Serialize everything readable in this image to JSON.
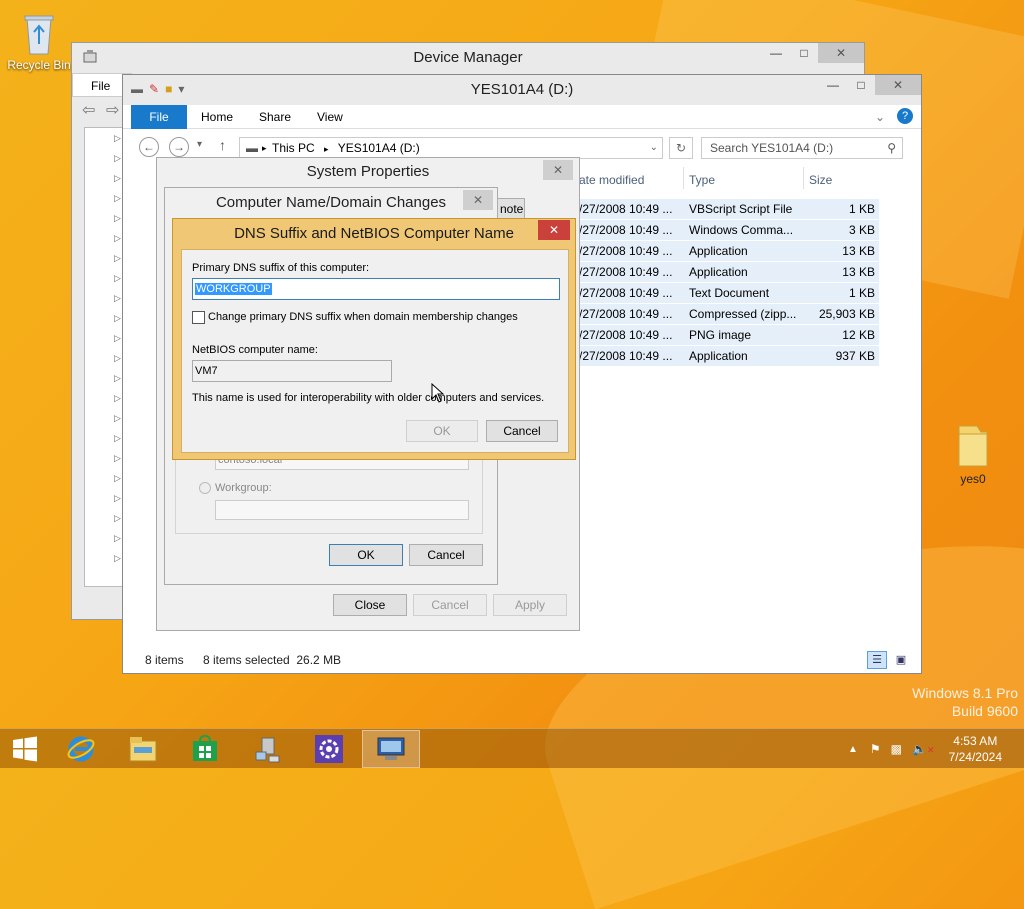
{
  "desktop": {
    "icons": [
      {
        "label": "Recycle Bin",
        "icon": "recycle-bin-icon"
      },
      {
        "label": "yes0",
        "icon": "folder-icon"
      }
    ],
    "watermark": {
      "line1": "Windows 8.1 Pro",
      "line2": "Build 9600"
    }
  },
  "device_manager": {
    "title": "Device Manager",
    "menu": {
      "file": "File"
    }
  },
  "explorer": {
    "title": "YES101A4 (D:)",
    "ribbon_tabs": [
      "File",
      "Home",
      "Share",
      "View"
    ],
    "address": {
      "crumb1": "This PC",
      "crumb2": "YES101A4 (D:)"
    },
    "search_placeholder": "Search YES101A4 (D:)",
    "columns": {
      "date": "ate modified",
      "type": "Type",
      "size": "Size"
    },
    "files": [
      {
        "date": "/27/2008 10:49 ...",
        "type": "VBScript Script File",
        "size": "1 KB"
      },
      {
        "date": "/27/2008 10:49 ...",
        "type": "Windows Comma...",
        "size": "3 KB"
      },
      {
        "date": "/27/2008 10:49 ...",
        "type": "Application",
        "size": "13 KB"
      },
      {
        "date": "/27/2008 10:49 ...",
        "type": "Application",
        "size": "13 KB"
      },
      {
        "date": "/27/2008 10:49 ...",
        "type": "Text Document",
        "size": "1 KB"
      },
      {
        "date": "/27/2008 10:49 ...",
        "type": "Compressed (zipp...",
        "size": "25,903 KB"
      },
      {
        "date": "/27/2008 10:49 ...",
        "type": "PNG image",
        "size": "12 KB"
      },
      {
        "date": "/27/2008 10:49 ...",
        "type": "Application",
        "size": "937 KB"
      }
    ],
    "status": {
      "count": "8 items",
      "selected": "8 items selected  26.2 MB"
    }
  },
  "system_properties": {
    "title": "System Properties",
    "buttons": {
      "close": "Close",
      "cancel": "Cancel",
      "apply": "Apply"
    }
  },
  "computer_name_changes": {
    "title": "Computer Name/Domain Changes",
    "partial_button": "note",
    "partial_domain_value": "contoso.local",
    "workgroup_label": "Workgroup:",
    "buttons": {
      "ok": "OK",
      "cancel": "Cancel"
    }
  },
  "dns_dialog": {
    "title": "DNS Suffix and NetBIOS Computer Name",
    "primary_label": "Primary DNS suffix of this computer:",
    "primary_value": "WORKGROUP",
    "checkbox_label": "Change primary DNS suffix when domain membership changes",
    "checkbox_checked": false,
    "netbios_label": "NetBIOS computer name:",
    "netbios_value": "VM7",
    "info_text": "This name is used for interoperability with older computers and services.",
    "buttons": {
      "ok": "OK",
      "cancel": "Cancel"
    }
  },
  "taskbar": {
    "apps": [
      "start-icon",
      "internet-explorer-icon",
      "file-explorer-icon",
      "store-icon",
      "network-setup-icon",
      "settings-gear-icon",
      "remote-desktop-icon"
    ],
    "clock": {
      "time": "4:53 AM",
      "date": "7/24/2024"
    }
  },
  "colors": {
    "accent": "#1979ca",
    "dns_frame": "#f0c875",
    "close_red": "#c9413a",
    "selection": "#3399ff"
  }
}
